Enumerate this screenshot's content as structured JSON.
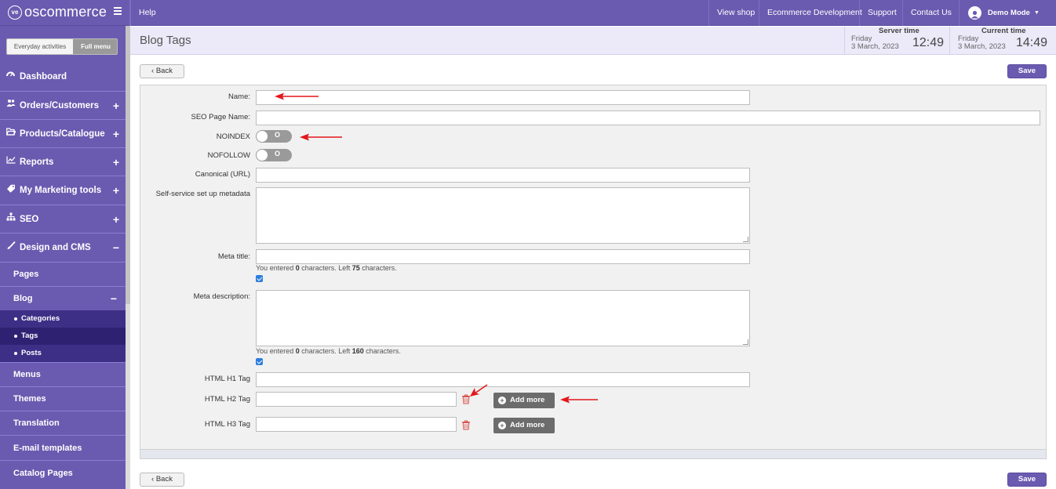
{
  "app": {
    "logo_text": "oscommerce",
    "logo_mark": "ve"
  },
  "topbar": {
    "help": "Help",
    "view_shop": "View shop",
    "ecommerce_dev": "Ecommerce Development",
    "support": "Support",
    "contact_us": "Contact Us",
    "user": "Demo Mode"
  },
  "sidebar": {
    "mode_everyday": "Everyday activities",
    "mode_full": "Full menu",
    "items": [
      {
        "label": "Dashboard",
        "icon": "dashboard-icon",
        "toggle": ""
      },
      {
        "label": "Orders/Customers",
        "icon": "users-icon",
        "toggle": "+"
      },
      {
        "label": "Products/Catalogue",
        "icon": "folder-icon",
        "toggle": "+"
      },
      {
        "label": "Reports",
        "icon": "chart-line-icon",
        "toggle": "+"
      },
      {
        "label": "My Marketing tools",
        "icon": "tag-icon",
        "toggle": "+"
      },
      {
        "label": "SEO",
        "icon": "sitemap-icon",
        "toggle": "+"
      },
      {
        "label": "Design and CMS",
        "icon": "brush-icon",
        "toggle": "−"
      }
    ],
    "sub": {
      "pages": "Pages",
      "blog": "Blog",
      "blog_toggle": "−",
      "categories": "Categories",
      "tags": "Tags",
      "posts": "Posts",
      "menus": "Menus",
      "themes": "Themes",
      "translation": "Translation",
      "email_templates": "E-mail templates",
      "catalog_pages": "Catalog Pages"
    }
  },
  "header": {
    "title": "Blog Tags",
    "server": {
      "caption": "Server time",
      "day": "Friday",
      "date": "3 March, 2023",
      "time": "12:49"
    },
    "current": {
      "caption": "Current time",
      "day": "Friday",
      "date": "3 March, 2023",
      "time": "14:49"
    }
  },
  "actions": {
    "back": "Back",
    "save": "Save"
  },
  "form": {
    "name_label": "Name:",
    "name_value": "",
    "seo_page_name_label": "SEO Page Name:",
    "seo_page_name_value": "",
    "noindex_label": "NOINDEX",
    "noindex_value": "O",
    "nofollow_label": "NOFOLLOW",
    "nofollow_value": "O",
    "canonical_label": "Canonical (URL)",
    "canonical_value": "",
    "metadata_label": "Self-service set up metadata",
    "metadata_value": "",
    "meta_title_label": "Meta title:",
    "meta_title_value": "",
    "meta_title_counter": {
      "prefix": "You entered ",
      "count": "0",
      "mid": " characters. Left ",
      "left": "75",
      "suffix": " characters."
    },
    "meta_title_checked": true,
    "meta_desc_label": "Meta description:",
    "meta_desc_value": "",
    "meta_desc_counter": {
      "prefix": "You entered ",
      "count": "0",
      "mid": " characters. Left ",
      "left": "160",
      "suffix": " characters."
    },
    "meta_desc_checked": true,
    "h1_label": "HTML H1 Tag",
    "h1_value": "",
    "h2_label": "HTML H2 Tag",
    "h2_value": "",
    "h3_label": "HTML H3 Tag",
    "h3_value": "",
    "add_more": "Add more"
  },
  "colors": {
    "brand": "#6a5bb0",
    "sidebar_active": "#3e2f86",
    "arrow": "#e3161c",
    "trash": "#d9534f"
  }
}
